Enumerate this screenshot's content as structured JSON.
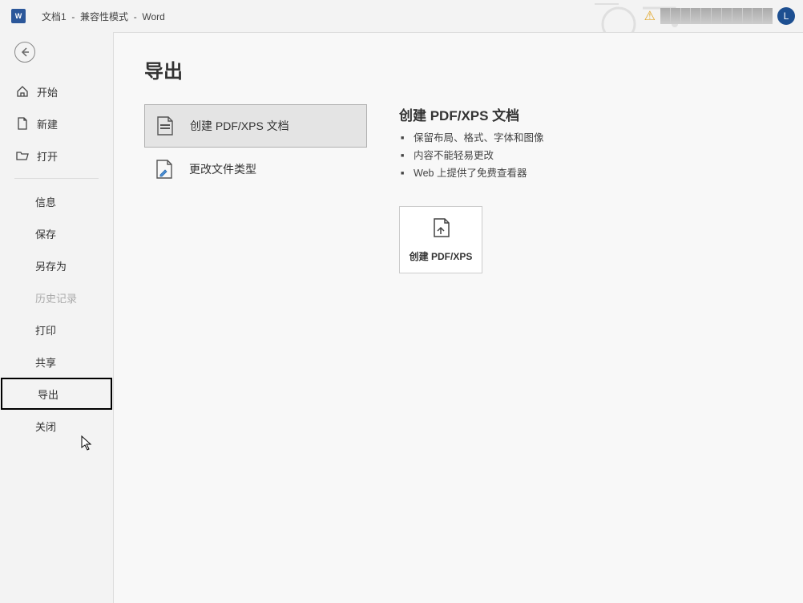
{
  "titlebar": {
    "doc_name": "文档1",
    "compat_mode": "兼容性模式",
    "app_name": "Word",
    "user_initial": "L"
  },
  "sidebar": {
    "items": [
      {
        "label": "开始",
        "icon": "home"
      },
      {
        "label": "新建",
        "icon": "document"
      },
      {
        "label": "打开",
        "icon": "folder"
      }
    ],
    "items2": [
      {
        "label": "信息"
      },
      {
        "label": "保存"
      },
      {
        "label": "另存为"
      },
      {
        "label": "历史记录",
        "disabled": true
      },
      {
        "label": "打印"
      },
      {
        "label": "共享"
      },
      {
        "label": "导出",
        "selected": true
      },
      {
        "label": "关闭"
      }
    ]
  },
  "content": {
    "title": "导出",
    "options": [
      {
        "label": "创建 PDF/XPS 文档",
        "active": true
      },
      {
        "label": "更改文件类型"
      }
    ],
    "right": {
      "heading": "创建 PDF/XPS 文档",
      "bullets": [
        "保留布局、格式、字体和图像",
        "内容不能轻易更改",
        "Web 上提供了免费查看器"
      ],
      "button_label": "创建 PDF/XPS"
    }
  }
}
